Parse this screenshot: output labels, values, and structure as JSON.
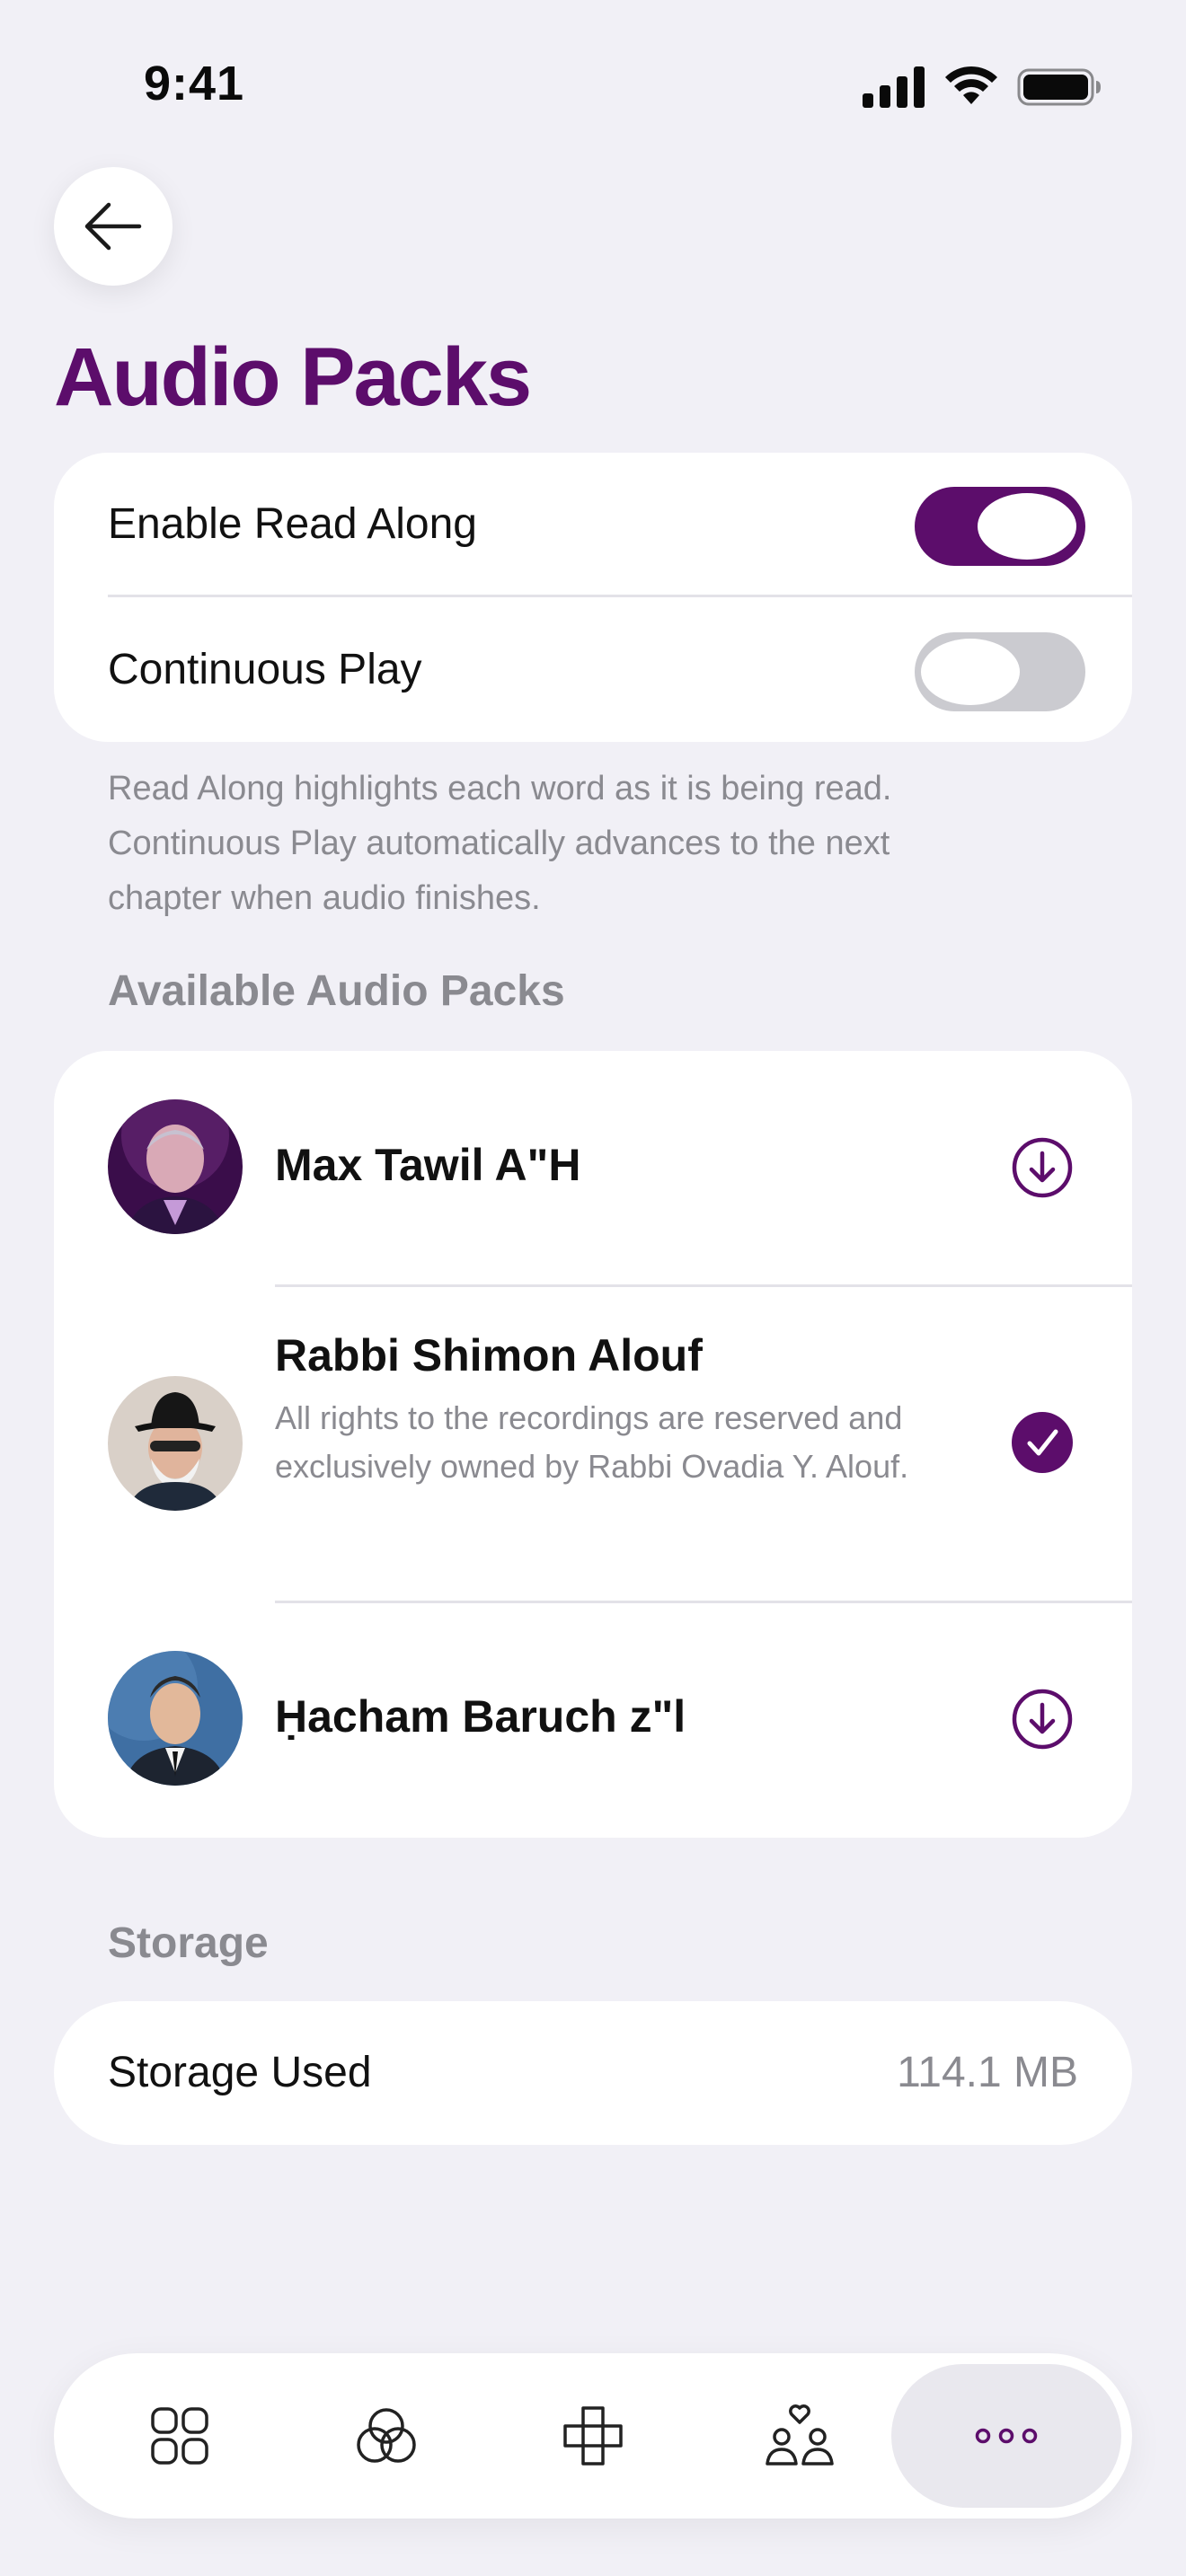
{
  "status_bar": {
    "time": "9:41",
    "icons": [
      "cellular-signal-icon",
      "wifi-icon",
      "battery-icon"
    ]
  },
  "header": {
    "back_icon": "arrow-left-icon",
    "title": "Audio Packs"
  },
  "settings": {
    "rows": [
      {
        "label": "Enable Read Along",
        "enabled": true
      },
      {
        "label": "Continuous Play",
        "enabled": false
      }
    ],
    "footnote": "Read Along highlights each word as it is being read. Continuous Play automatically advances to the next chapter when audio finishes."
  },
  "packs": {
    "header": "Available Audio Packs",
    "items": [
      {
        "name": "Max Tawil A\"H",
        "description": "",
        "status_icon": "download-icon",
        "downloaded": false
      },
      {
        "name": "Rabbi Shimon Alouf",
        "description": "All rights to the recordings are reserved and exclusively owned by Rabbi Ovadia Y. Alouf.",
        "status_icon": "checkmark-icon",
        "downloaded": true
      },
      {
        "name": "Ḥacham Baruch z\"l",
        "description": "",
        "status_icon": "download-icon",
        "downloaded": false
      }
    ]
  },
  "storage": {
    "header": "Storage",
    "label": "Storage Used",
    "value": "114.1 MB"
  },
  "tab_bar": {
    "tabs": [
      {
        "icon": "grid-icon",
        "active": false
      },
      {
        "icon": "circles-icon",
        "active": false
      },
      {
        "icon": "cross-icon",
        "active": false
      },
      {
        "icon": "community-icon",
        "active": false
      },
      {
        "icon": "more-icon",
        "active": true
      }
    ]
  },
  "colors": {
    "accent": "#5c0d6b",
    "background": "#f1f0f6",
    "secondary_text": "#8a8a90",
    "toggle_off": "#cbcbd0"
  }
}
